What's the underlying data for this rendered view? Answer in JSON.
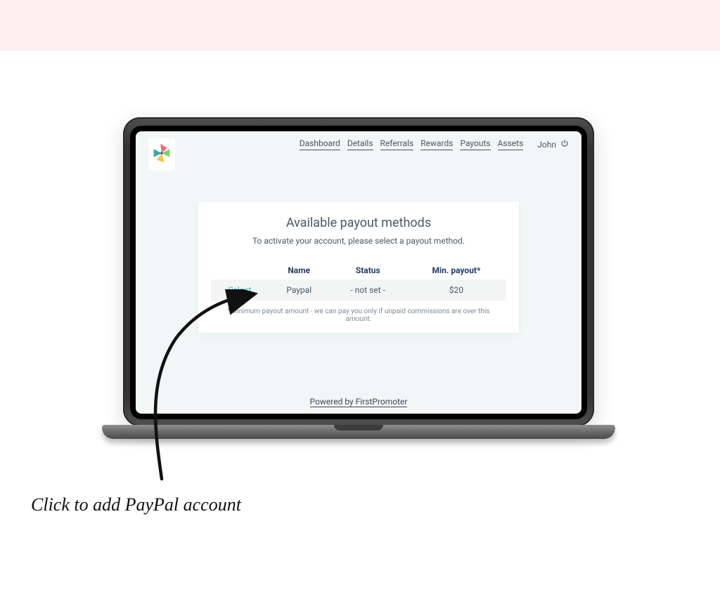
{
  "nav": {
    "items": [
      "Dashboard",
      "Details",
      "Referrals",
      "Rewards",
      "Payouts",
      "Assets"
    ],
    "user": "John"
  },
  "panel": {
    "title": "Available payout methods",
    "subtitle": "To activate your account, please select a payout method.",
    "columns": {
      "c0": "",
      "c1": "Name",
      "c2": "Status",
      "c3": "Min. payout*"
    },
    "rows": [
      {
        "action": "Select",
        "name": "Paypal",
        "status": "- not set -",
        "min": "$20"
      }
    ],
    "footnote": "*Minimum payout amount - we can pay you only if unpaid commissions are over this amount."
  },
  "footer": {
    "powered": "Powered by FirstPromoter"
  },
  "annotation": {
    "caption": "Click to add PayPal account"
  }
}
